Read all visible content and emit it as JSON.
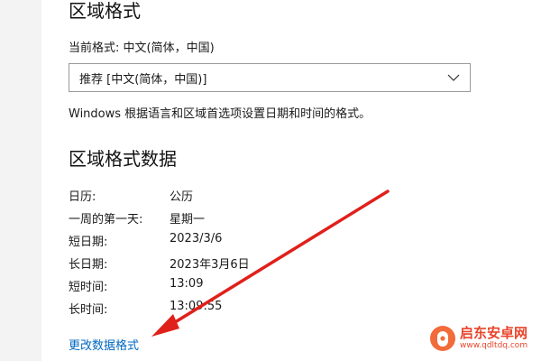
{
  "region_format": {
    "title": "区域格式",
    "current_label": "当前格式:",
    "current_value": "中文(简体，中国)",
    "dropdown_value": "推荐 [中文(简体，中国)]",
    "description": "Windows 根据语言和区域首选项设置日期和时间的格式。"
  },
  "format_data": {
    "title": "区域格式数据",
    "rows": [
      {
        "key": "日历:",
        "value": "公历"
      },
      {
        "key": "一周的第一天:",
        "value": "星期一"
      },
      {
        "key": "短日期:",
        "value": "2023/3/6"
      },
      {
        "key": "长日期:",
        "value": "2023年3月6日"
      },
      {
        "key": "短时间:",
        "value": "13:09"
      },
      {
        "key": "长时间:",
        "value": "13:09:55"
      }
    ],
    "change_link": "更改数据格式"
  },
  "watermark": {
    "title": "启东安卓网",
    "url": "www.qdltdq.com"
  },
  "colors": {
    "link": "#0067c0",
    "arrow": "#e0201a",
    "watermark": "#e8452c"
  }
}
